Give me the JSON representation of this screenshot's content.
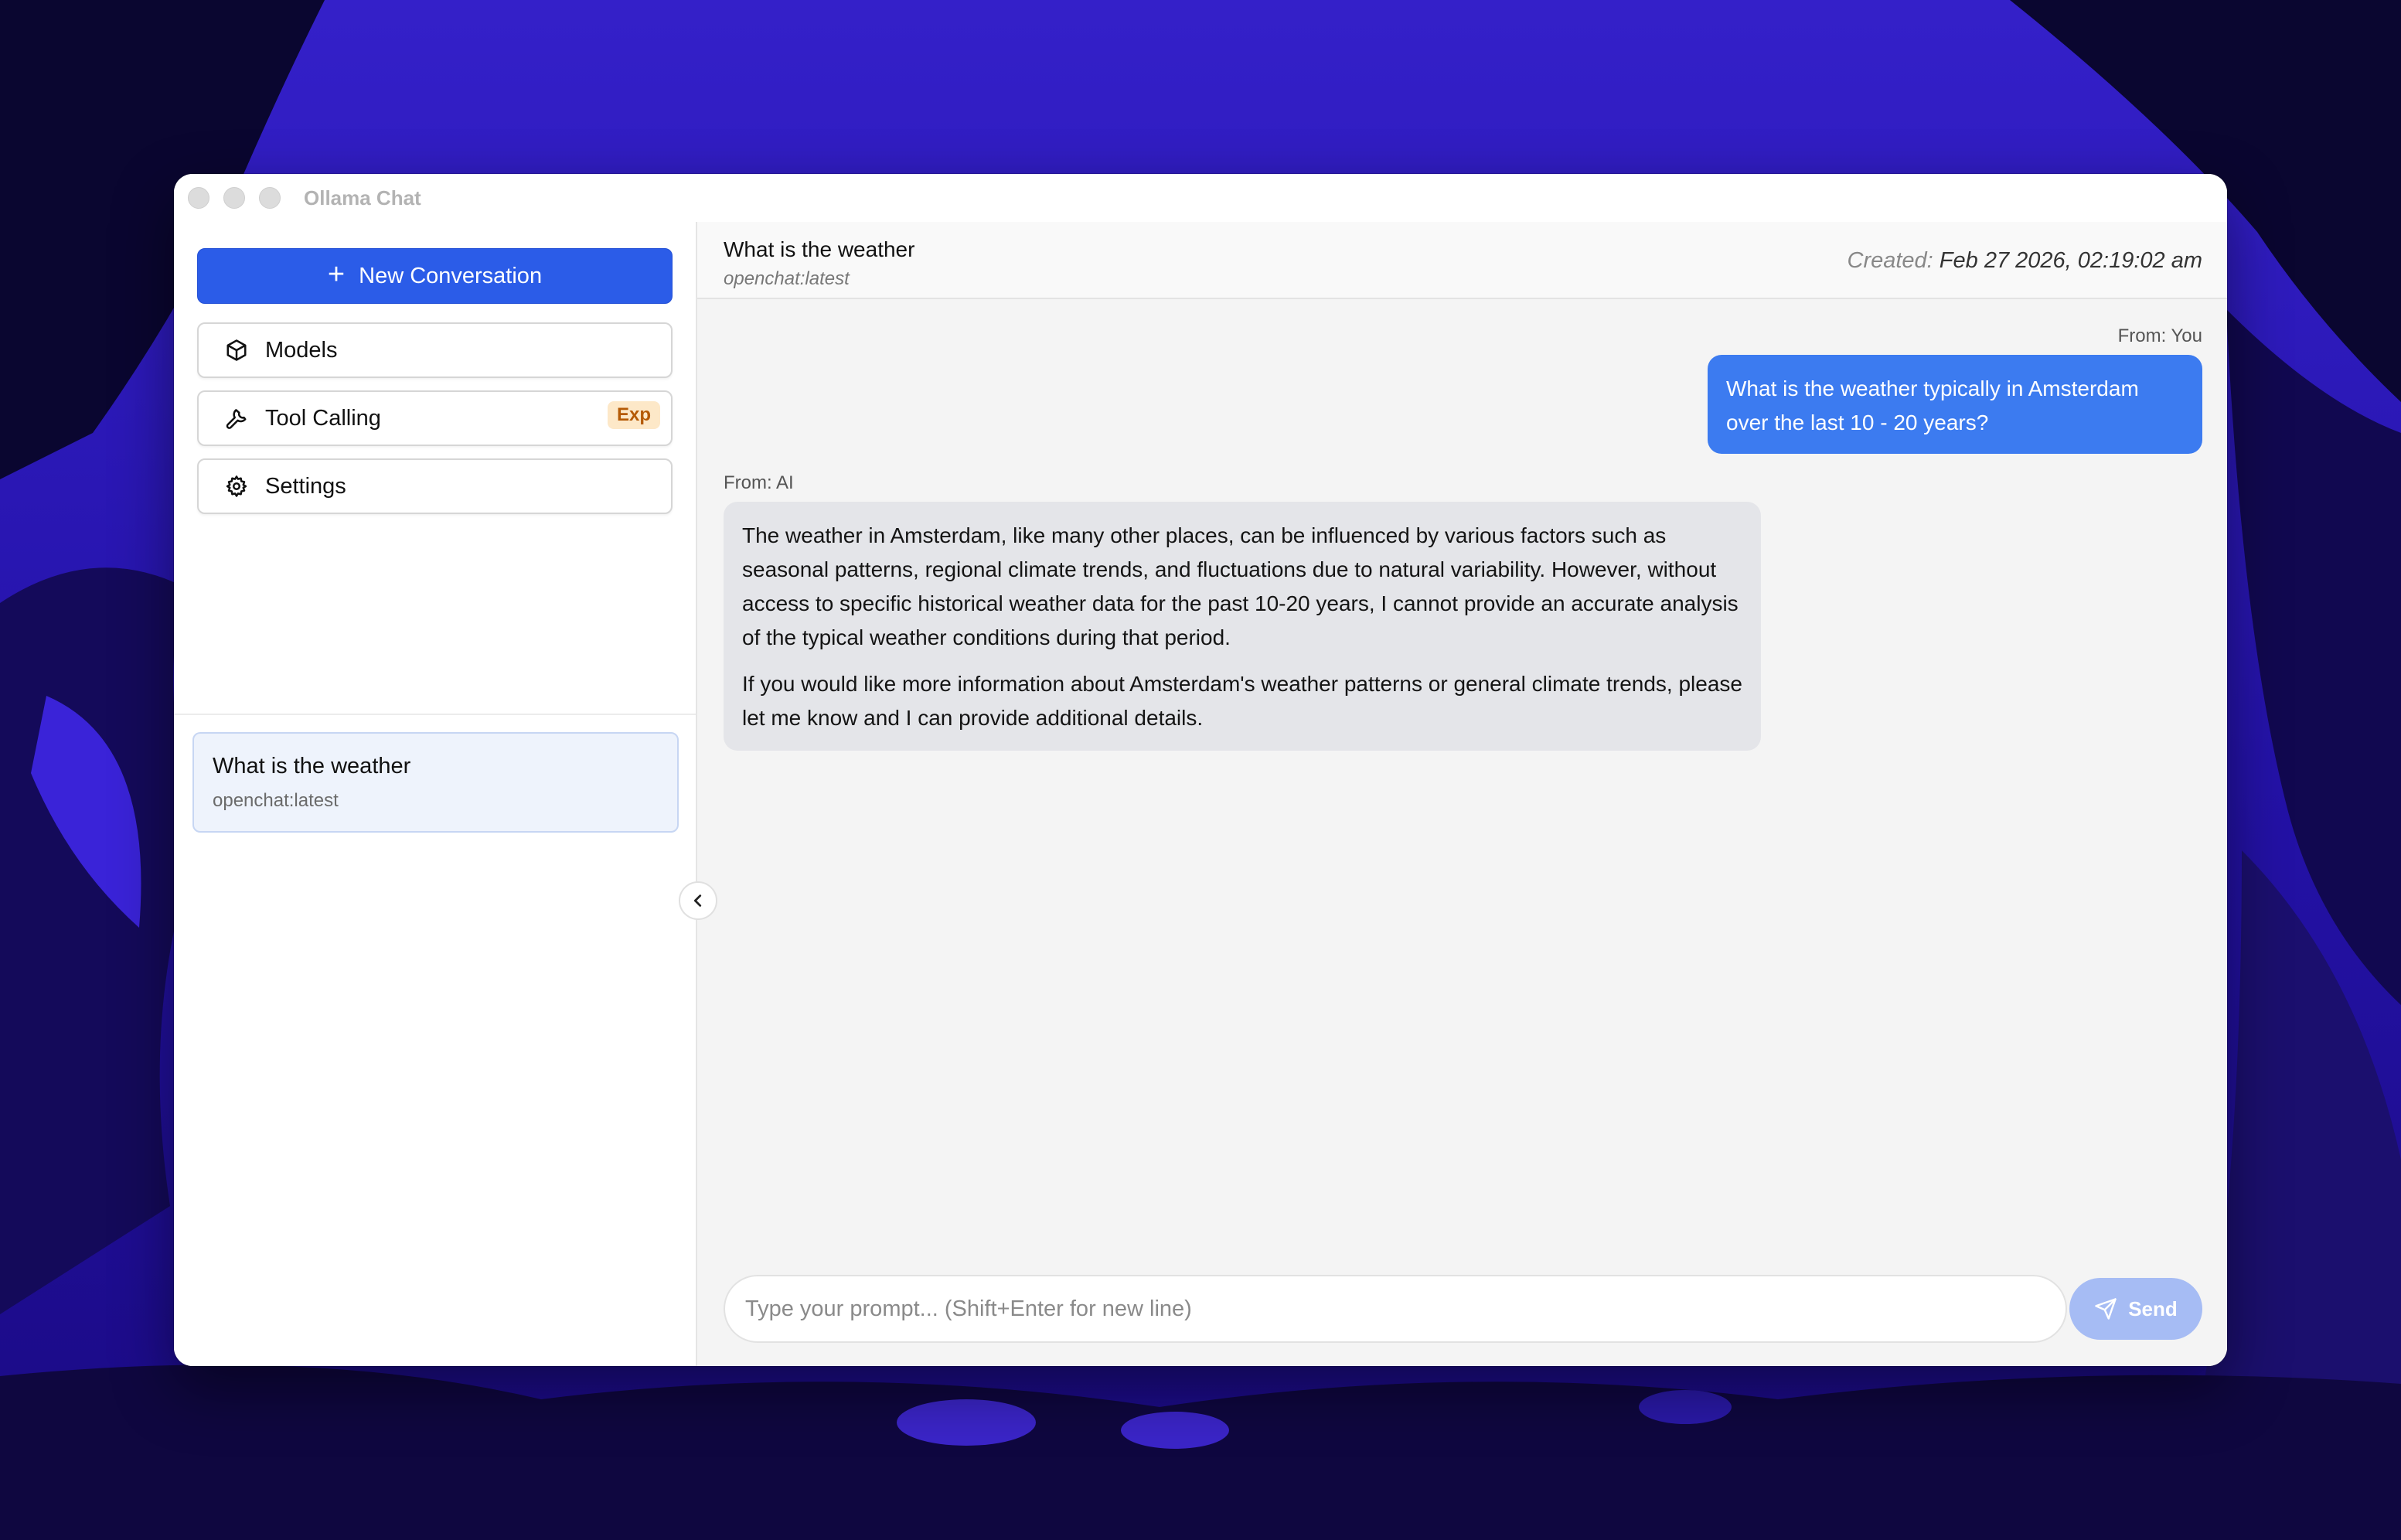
{
  "window": {
    "title": "Ollama Chat"
  },
  "sidebar": {
    "new_conversation": "New Conversation",
    "nav": [
      {
        "label": "Models",
        "icon": "cube-icon"
      },
      {
        "label": "Tool Calling",
        "icon": "wrench-icon",
        "badge": "Exp"
      },
      {
        "label": "Settings",
        "icon": "gear-icon"
      }
    ],
    "conversations": [
      {
        "title": "What is the weather",
        "model": "openchat:latest"
      }
    ]
  },
  "chat": {
    "title": "What is the weather",
    "model": "openchat:latest",
    "created_label": "Created:",
    "created_value": "Feb 27 2026, 02:19:02 am",
    "messages": [
      {
        "from": "From: You",
        "text": "What is the weather typically in Amsterdam over the last 10 - 20 years?"
      },
      {
        "from": "From: AI",
        "paragraphs": [
          "The weather in Amsterdam, like many other places, can be influenced by various factors such as seasonal patterns, regional climate trends, and fluctuations due to natural variability. However, without access to specific historical weather data for the past 10-20 years, I cannot provide an accurate analysis of the typical weather conditions during that period.",
          "If you would like more information about Amsterdam's weather patterns or general climate trends, please let me know and I can provide additional details."
        ]
      }
    ]
  },
  "composer": {
    "placeholder": "Type your prompt... (Shift+Enter for new line)",
    "send_label": "Send"
  },
  "colors": {
    "primary": "#2b5ce8",
    "user_bubble": "#3c7bf0",
    "ai_bubble": "#e4e5e9",
    "send_disabled": "#a6bcf4",
    "badge_bg": "#fde8c8",
    "badge_fg": "#b55a06"
  }
}
